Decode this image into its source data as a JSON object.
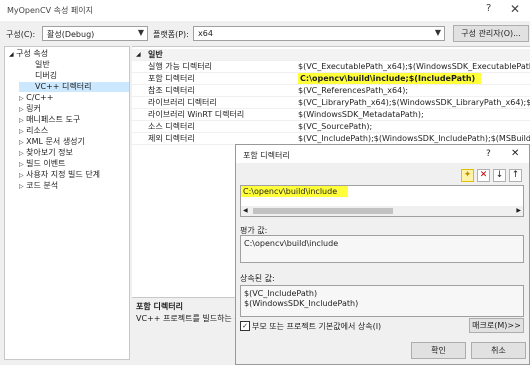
{
  "window": {
    "title": "MyOpenCV 속성 페이지",
    "help": "?",
    "close": "✕"
  },
  "toolbar": {
    "config_label": "구성(C):",
    "config_value": "활성(Debug)",
    "platform_label": "플랫폼(P):",
    "platform_value": "x64",
    "config_manager": "구성 관리자(O)..."
  },
  "tree": {
    "items": [
      {
        "label": "구성 속성",
        "expander": "◢"
      },
      {
        "label": "일반",
        "expander": ""
      },
      {
        "label": "디버깅",
        "expander": ""
      },
      {
        "label": "VC++ 디렉터리",
        "expander": ""
      },
      {
        "label": "C/C++",
        "expander": "▷"
      },
      {
        "label": "링커",
        "expander": "▷"
      },
      {
        "label": "매니페스트 도구",
        "expander": "▷"
      },
      {
        "label": "리소스",
        "expander": "▷"
      },
      {
        "label": "XML 문서 생성기",
        "expander": "▷"
      },
      {
        "label": "찾아보기 정보",
        "expander": "▷"
      },
      {
        "label": "빌드 이벤트",
        "expander": "▷"
      },
      {
        "label": "사용자 지정 빌드 단계",
        "expander": "▷"
      },
      {
        "label": "코드 분석",
        "expander": "▷"
      }
    ]
  },
  "grid": {
    "section": "일반",
    "rows": [
      {
        "name": "실행 가능 디렉터리",
        "value": "$(VC_ExecutablePath_x64);$(WindowsSDK_ExecutablePath);$(VS_Ex"
      },
      {
        "name": "포함 디렉터리",
        "value": "C:\\opencv\\build\\include;$(IncludePath)"
      },
      {
        "name": "참조 디렉터리",
        "value": "$(VC_ReferencesPath_x64);"
      },
      {
        "name": "라이브러리 디렉터리",
        "value": "$(VC_LibraryPath_x64);$(WindowsSDK_LibraryPath_x64);$(NETFXKit"
      },
      {
        "name": "라이브러리 WinRT 디렉터리",
        "value": "$(WindowsSDK_MetadataPath);"
      },
      {
        "name": "소스 디렉터리",
        "value": "$(VC_SourcePath);"
      },
      {
        "name": "제외 디렉터리",
        "value": "$(VC_IncludePath);$(WindowsSDK_IncludePath);$(MSBuild_Executa"
      }
    ]
  },
  "description": {
    "title": "포함 디렉터리",
    "text": "VC++ 프로젝트를 빌드하는 중"
  },
  "dialog": {
    "title": "포함 디렉터리",
    "help": "?",
    "close": "✕",
    "list_items": [
      "C:\\opencv\\build\\include"
    ],
    "evaluated_label": "평가 값:",
    "evaluated_items": [
      "C:\\opencv\\build\\include"
    ],
    "inherited_label": "상속된 값:",
    "inherited_items": [
      "$(VC_IncludePath)",
      "$(WindowsSDK_IncludePath)"
    ],
    "inherit_checkbox_label": "부모 또는 프로젝트 기본값에서 상속(I)",
    "inherit_checked": true,
    "macro_button": "매크로(M)>>",
    "ok_button": "확인",
    "cancel_button": "취소"
  },
  "colors": {
    "highlight": "#ffff3a",
    "selection": "#cce8ff"
  }
}
